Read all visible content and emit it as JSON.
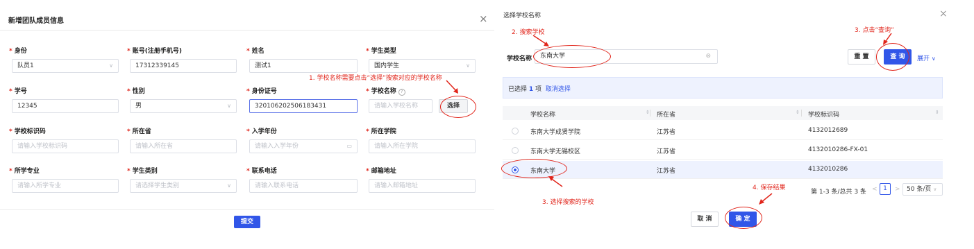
{
  "left": {
    "title": "新增团队成员信息",
    "close_glyph": "×",
    "fields": [
      {
        "label": "身份",
        "required": true,
        "value": "队员1",
        "placeholder": "",
        "type": "select"
      },
      {
        "label": "账号(注册手机号)",
        "required": true,
        "value": "17312339145",
        "placeholder": "",
        "type": "input"
      },
      {
        "label": "姓名",
        "required": true,
        "value": "测试1",
        "placeholder": "",
        "type": "input"
      },
      {
        "label": "学生类型",
        "required": true,
        "value": "国内学生",
        "placeholder": "",
        "type": "select"
      },
      {
        "label": "学号",
        "required": true,
        "value": "12345",
        "placeholder": "",
        "type": "input"
      },
      {
        "label": "性别",
        "required": true,
        "value": "男",
        "placeholder": "",
        "type": "select"
      },
      {
        "label": "身份证号",
        "required": true,
        "value": "320106202506183431",
        "placeholder": "",
        "type": "input"
      },
      {
        "label": "学校名称",
        "required": true,
        "value": "",
        "placeholder": "请输入学校名称",
        "type": "school"
      },
      {
        "label": "学校标识码",
        "required": true,
        "value": "",
        "placeholder": "请输入学校标识码",
        "type": "input"
      },
      {
        "label": "所在省",
        "required": true,
        "value": "",
        "placeholder": "请输入所在省",
        "type": "input"
      },
      {
        "label": "入学年份",
        "required": true,
        "value": "",
        "placeholder": "请输入入学年份",
        "type": "date"
      },
      {
        "label": "所在学院",
        "required": true,
        "value": "",
        "placeholder": "请输入所在学院",
        "type": "input"
      },
      {
        "label": "所学专业",
        "required": true,
        "value": "",
        "placeholder": "请输入所学专业",
        "type": "input"
      },
      {
        "label": "学生类别",
        "required": true,
        "value": "",
        "placeholder": "请选择学生类别",
        "type": "select"
      },
      {
        "label": "联系电话",
        "required": true,
        "value": "",
        "placeholder": "请输入联系电话",
        "type": "input"
      },
      {
        "label": "邮箱地址",
        "required": true,
        "value": "",
        "placeholder": "请输入邮箱地址",
        "type": "input"
      }
    ],
    "select_button": "选择",
    "submit_button": "提交",
    "annotation_1": "1. 学校名称需要点击“选择”搜索对应的学校名称"
  },
  "right": {
    "title": "选择学校名称",
    "close_glyph": "×",
    "search_label": "学校名称",
    "search_value": "东南大学",
    "reset_button": "重 置",
    "query_button": "查 询",
    "expand_link": "展开",
    "selection_prefix": "已选择",
    "selection_count": "1",
    "selection_suffix": "项",
    "cancel_selection": "取消选择",
    "columns": [
      "学校名称",
      "所在省",
      "学校标识码"
    ],
    "rows": [
      {
        "name": "东南大学成贤学院",
        "province": "江苏省",
        "code": "4132012689",
        "selected": false
      },
      {
        "name": "东南大学无锡校区",
        "province": "江苏省",
        "code": "4132010286-FX-01",
        "selected": false
      },
      {
        "name": "东南大学",
        "province": "江苏省",
        "code": "4132010286",
        "selected": true
      }
    ],
    "pagination_text": "第 1-3 条/总共 3 条",
    "current_page": "1",
    "page_size": "50 条/页",
    "cancel_button": "取 消",
    "confirm_button": "确 定",
    "annotation_2": "2. 搜索学校",
    "annotation_3": "3. 点击“查询”",
    "annotation_3b": "3. 选择搜索的学校",
    "annotation_4": "4. 保存结果"
  },
  "colors": {
    "primary": "#3156e8",
    "annotation": "#e1251b"
  },
  "icons": [
    "close-icon",
    "chevron-down-icon",
    "calendar-icon",
    "help-icon",
    "clear-icon",
    "arrow-annotation-icon",
    "sort-icon"
  ]
}
